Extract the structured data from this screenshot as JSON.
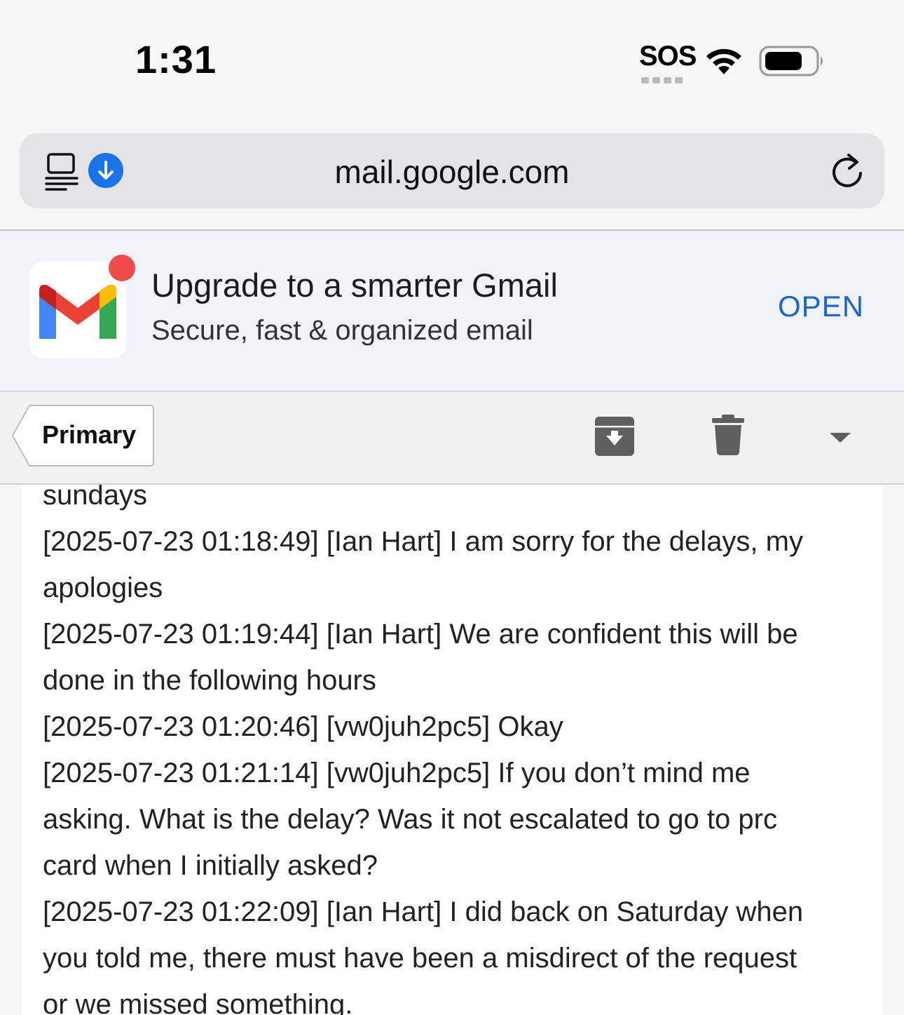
{
  "status_bar": {
    "time": "1:31",
    "sos": "SOS"
  },
  "url_bar": {
    "url": "mail.google.com"
  },
  "promo": {
    "title": "Upgrade to a smarter Gmail",
    "subtitle": "Secure, fast & organized email",
    "open_label": "OPEN"
  },
  "toolbar": {
    "back_label": "Primary"
  },
  "email": {
    "lines": [
      "sundays",
      "[2025-07-23 01:18:49] [Ian Hart] I am sorry for the delays, my",
      "apologies",
      "[2025-07-23 01:19:44] [Ian Hart] We are confident this will be",
      "done in the following hours",
      "[2025-07-23 01:20:46] [vw0juh2pc5] Okay",
      "[2025-07-23 01:21:14] [vw0juh2pc5] If you don’t mind me",
      "asking. What is the delay? Was it not escalated to go to prc",
      "card when I initially asked?",
      "[2025-07-23 01:22:09] [Ian Hart] I did back on Saturday when",
      "you told me, there must have been a misdirect of the request",
      "or we missed something."
    ]
  },
  "colors": {
    "accent_blue": "#1a66d2",
    "notification_red": "#f04b4b",
    "download_blue": "#1a73e8"
  }
}
